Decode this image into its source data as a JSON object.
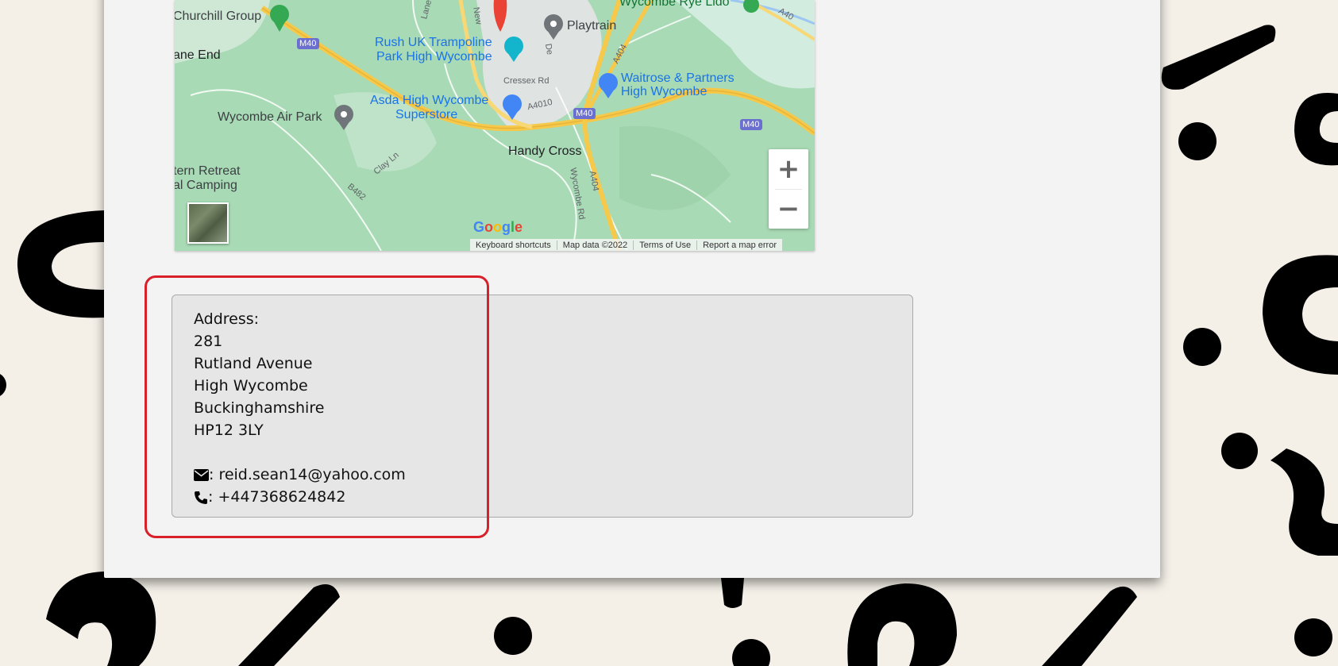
{
  "map": {
    "places": {
      "churchill": "Churchill Group",
      "lane_end": "ane End",
      "rush_line1": "Rush UK Trampoline",
      "rush_line2": "Park High Wycombe",
      "playtrain": "Playtrain",
      "rye_lido": "Wycombe Rye Lido",
      "waitrose_line1": "Waitrose & Partners",
      "waitrose_line2": "High Wycombe",
      "asda_line1": "Asda High Wycombe",
      "asda_line2": "Superstore",
      "air_park": "Wycombe Air Park",
      "handy_cross": "Handy Cross",
      "retreat_line1": "tern Retreat",
      "retreat_line2": "al Camping",
      "cressex": "Cressex Rd"
    },
    "roads": {
      "m40_a": "M40",
      "m40_b": "M40",
      "m40_c": "M40",
      "a4010": "A4010",
      "a404_a": "A404",
      "a404_b": "A404",
      "a40": "A40",
      "b482": "B482",
      "clay_ln": "Clay Ln",
      "wycombe_rd": "Wycombe Rd",
      "lane": "Lane",
      "new": "New",
      "de": "De"
    },
    "zoom_in_label": "+",
    "zoom_out_label": "−",
    "logo_text": "Google",
    "attribution": {
      "shortcuts": "Keyboard shortcuts",
      "map_data": "Map data ©2022",
      "terms": "Terms of Use",
      "report": "Report a map error"
    }
  },
  "contact": {
    "address_heading": "Address:",
    "house_number": "281",
    "street": "Rutland Avenue",
    "town": "High Wycombe",
    "county": "Buckinghamshire",
    "postcode": "HP12 3LY",
    "email": ": reid.sean14@yahoo.com",
    "phone": ": +447368624842",
    "email_icon": "envelope-icon",
    "phone_icon": "phone-icon"
  },
  "colors": {
    "background": "#f4f0e8",
    "card": "#f3f3f3",
    "map_green": "#a8dab5",
    "highlight": "#d81f2a",
    "road_yellow": "#f6c94a"
  }
}
